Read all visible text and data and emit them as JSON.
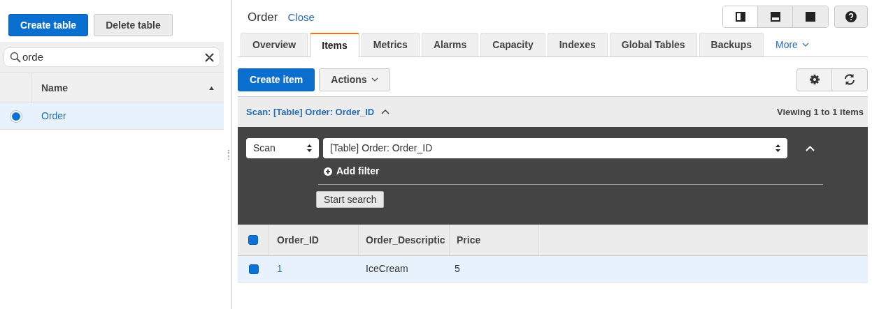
{
  "sidebar": {
    "buttons": [
      {
        "label": "Create table",
        "kind": "primary"
      },
      {
        "label": "Delete table",
        "kind": "secondary"
      }
    ],
    "search": {
      "value": "orde"
    },
    "table": {
      "columns": [
        "Name"
      ],
      "rows": [
        {
          "name": "Order",
          "selected": true
        }
      ]
    }
  },
  "main": {
    "title": "Order",
    "close": "Close",
    "tabs": [
      {
        "label": "Overview",
        "selected": false
      },
      {
        "label": "Items",
        "selected": true
      },
      {
        "label": "Metrics",
        "selected": false
      },
      {
        "label": "Alarms",
        "selected": false
      },
      {
        "label": "Capacity",
        "selected": false
      },
      {
        "label": "Indexes",
        "selected": false
      },
      {
        "label": "Global Tables",
        "selected": false
      },
      {
        "label": "Backups",
        "selected": false
      }
    ],
    "more": "More",
    "toolbar": {
      "buttons": [
        {
          "label": "Create item",
          "kind": "primary"
        },
        {
          "label": "Actions",
          "kind": "dropdown"
        }
      ]
    },
    "scan_bar": {
      "title": "Scan: [Table] Order: Order_ID",
      "count": "Viewing 1 to 1 items"
    },
    "query": {
      "mode": "Scan",
      "target": "[Table] Order: Order_ID",
      "add_filter": "Add filter",
      "start": "Start search"
    },
    "items": {
      "columns": [
        "Order_ID",
        "Order_Descriptic",
        "Price"
      ],
      "all_checked": true,
      "rows": [
        {
          "checked": true,
          "cells": [
            "1",
            "IceCream",
            "5"
          ]
        }
      ]
    }
  }
}
